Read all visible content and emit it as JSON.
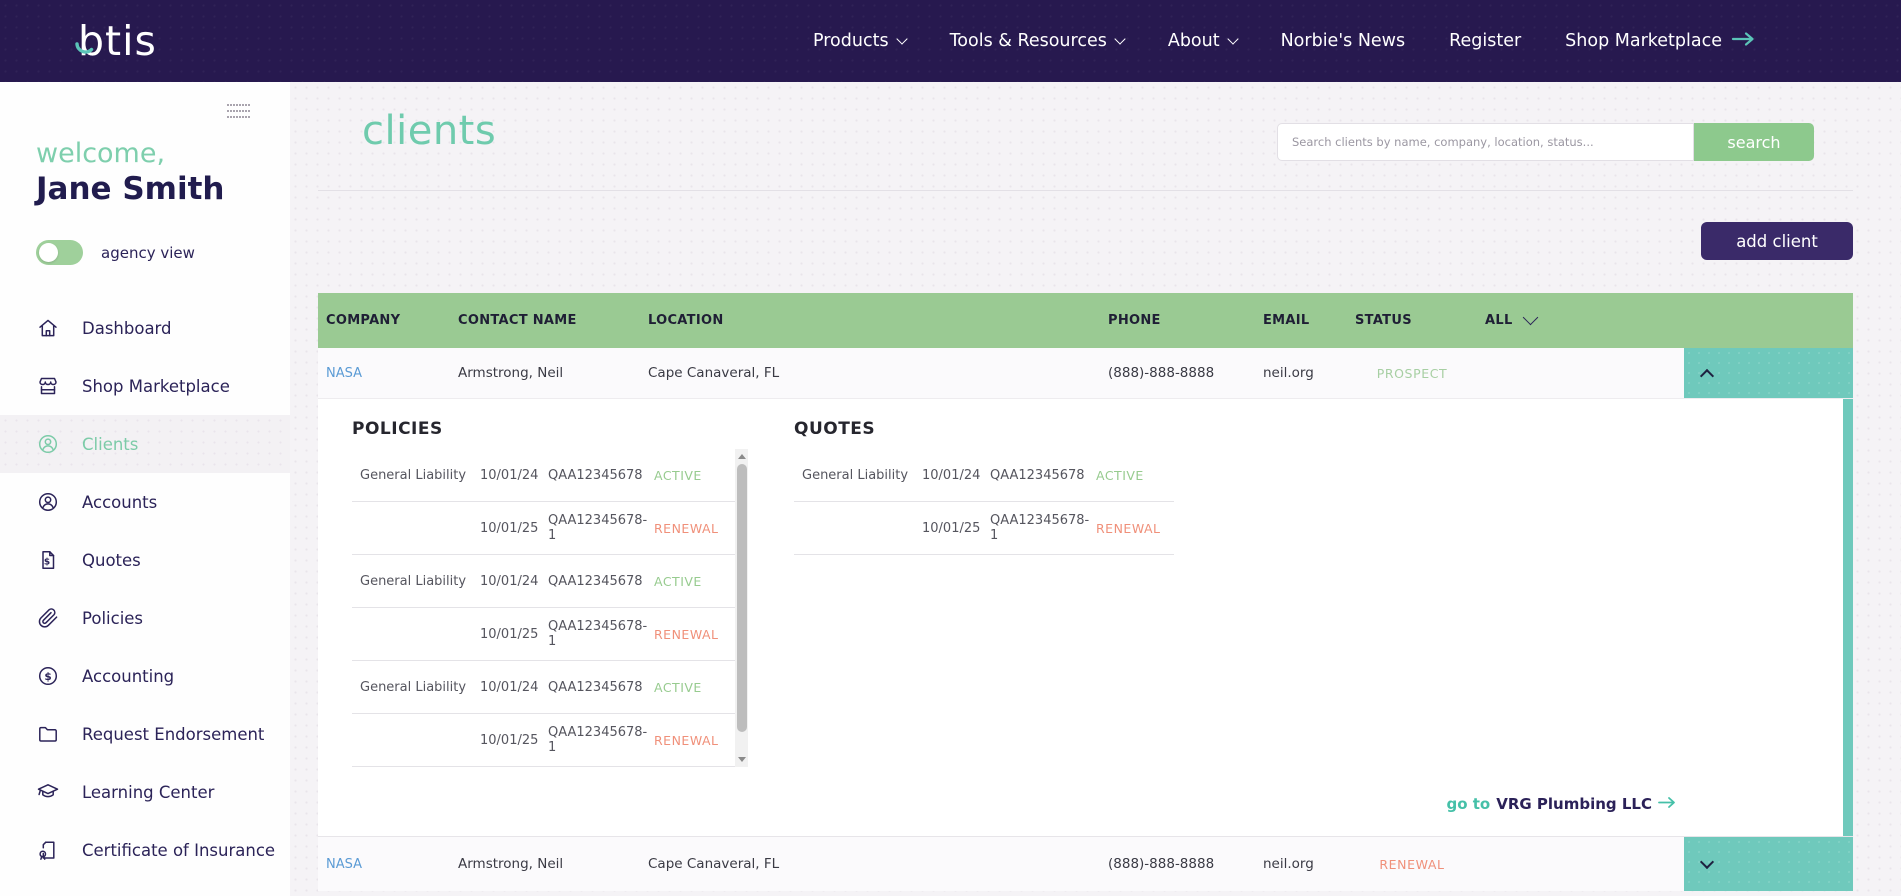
{
  "topnav": {
    "logo": "btis",
    "items": [
      {
        "label": "Products",
        "has_dropdown": true
      },
      {
        "label": "Tools & Resources",
        "has_dropdown": true
      },
      {
        "label": "About",
        "has_dropdown": true
      },
      {
        "label": "Norbie's News",
        "has_dropdown": false
      },
      {
        "label": "Register",
        "has_dropdown": false
      },
      {
        "label": "Shop Marketplace",
        "has_dropdown": false,
        "icon": "arrow-right-icon"
      }
    ]
  },
  "sidebar": {
    "welcome": "welcome,",
    "user_name": "Jane Smith",
    "toggle_label": "agency view",
    "toggle_state": "off-left-knob",
    "items": [
      {
        "label": "Dashboard",
        "icon": "home-icon",
        "active": false
      },
      {
        "label": "Shop Marketplace",
        "icon": "storefront-icon",
        "active": false
      },
      {
        "label": "Clients",
        "icon": "person-circle-icon",
        "active": true
      },
      {
        "label": "Accounts",
        "icon": "person-circle-icon",
        "active": false
      },
      {
        "label": "Quotes",
        "icon": "document-dollar-icon",
        "active": false
      },
      {
        "label": "Policies",
        "icon": "paperclip-icon",
        "active": false
      },
      {
        "label": "Accounting",
        "icon": "dollar-circle-icon",
        "active": false
      },
      {
        "label": "Request Endorsement",
        "icon": "folder-icon",
        "active": false
      },
      {
        "label": "Learning Center",
        "icon": "graduation-cap-icon",
        "active": false
      },
      {
        "label": "Certificate of Insurance",
        "icon": "certificate-icon",
        "active": false
      }
    ]
  },
  "main": {
    "title": "clients",
    "search": {
      "placeholder": "Search clients by name, company, location, status...",
      "button": "search"
    },
    "add_client_label": "add client",
    "table": {
      "columns": [
        "COMPANY",
        "CONTACT NAME",
        "LOCATION",
        "PHONE",
        "EMAIL",
        "STATUS"
      ],
      "filter_label": "ALL",
      "rows": [
        {
          "company": "NASA",
          "contact": "Armstrong, Neil",
          "location": "Cape Canaveral, FL",
          "phone": "(888)-888-8888",
          "email": "neil.org",
          "status": "PROSPECT",
          "expanded": true
        },
        {
          "company": "NASA",
          "contact": "Armstrong, Neil",
          "location": "Cape Canaveral, FL",
          "phone": "(888)-888-8888",
          "email": "neil.org",
          "status": "RENEWAL",
          "expanded": false
        }
      ]
    },
    "expanded": {
      "policies_title": "POLICIES",
      "policies": [
        {
          "type": "General Liability",
          "date": "10/01/24",
          "number": "QAA12345678",
          "status": "ACTIVE"
        },
        {
          "type": "",
          "date": "10/01/25",
          "number": "QAA12345678-1",
          "status": "RENEWAL"
        },
        {
          "type": "General Liability",
          "date": "10/01/24",
          "number": "QAA12345678",
          "status": "ACTIVE"
        },
        {
          "type": "",
          "date": "10/01/25",
          "number": "QAA12345678-1",
          "status": "RENEWAL"
        },
        {
          "type": "General Liability",
          "date": "10/01/24",
          "number": "QAA12345678",
          "status": "ACTIVE"
        },
        {
          "type": "",
          "date": "10/01/25",
          "number": "QAA12345678-1",
          "status": "RENEWAL"
        }
      ],
      "quotes_title": "QUOTES",
      "quotes": [
        {
          "type": "General Liability",
          "date": "10/01/24",
          "number": "QAA12345678",
          "status": "ACTIVE"
        },
        {
          "type": "",
          "date": "10/01/25",
          "number": "QAA12345678-1",
          "status": "RENEWAL"
        }
      ],
      "goto_prefix": "go to",
      "goto_target": "VRG Plumbing LLC"
    },
    "colors": {
      "navbar": "#27194F",
      "brand_teal": "#5BC4B8",
      "table_header_green": "#9ACA93",
      "expander_teal": "#6FC9BC",
      "button_purple": "#3A2A69",
      "button_green": "#8DC98D",
      "title_green": "#6FCBAD",
      "status_active_green": "#97CB8F",
      "status_prospect_green": "#A7CFA3",
      "status_renewal_salmon": "#F0907A",
      "link_blue": "#5B9BD5",
      "text_navy": "#2B2358"
    }
  }
}
